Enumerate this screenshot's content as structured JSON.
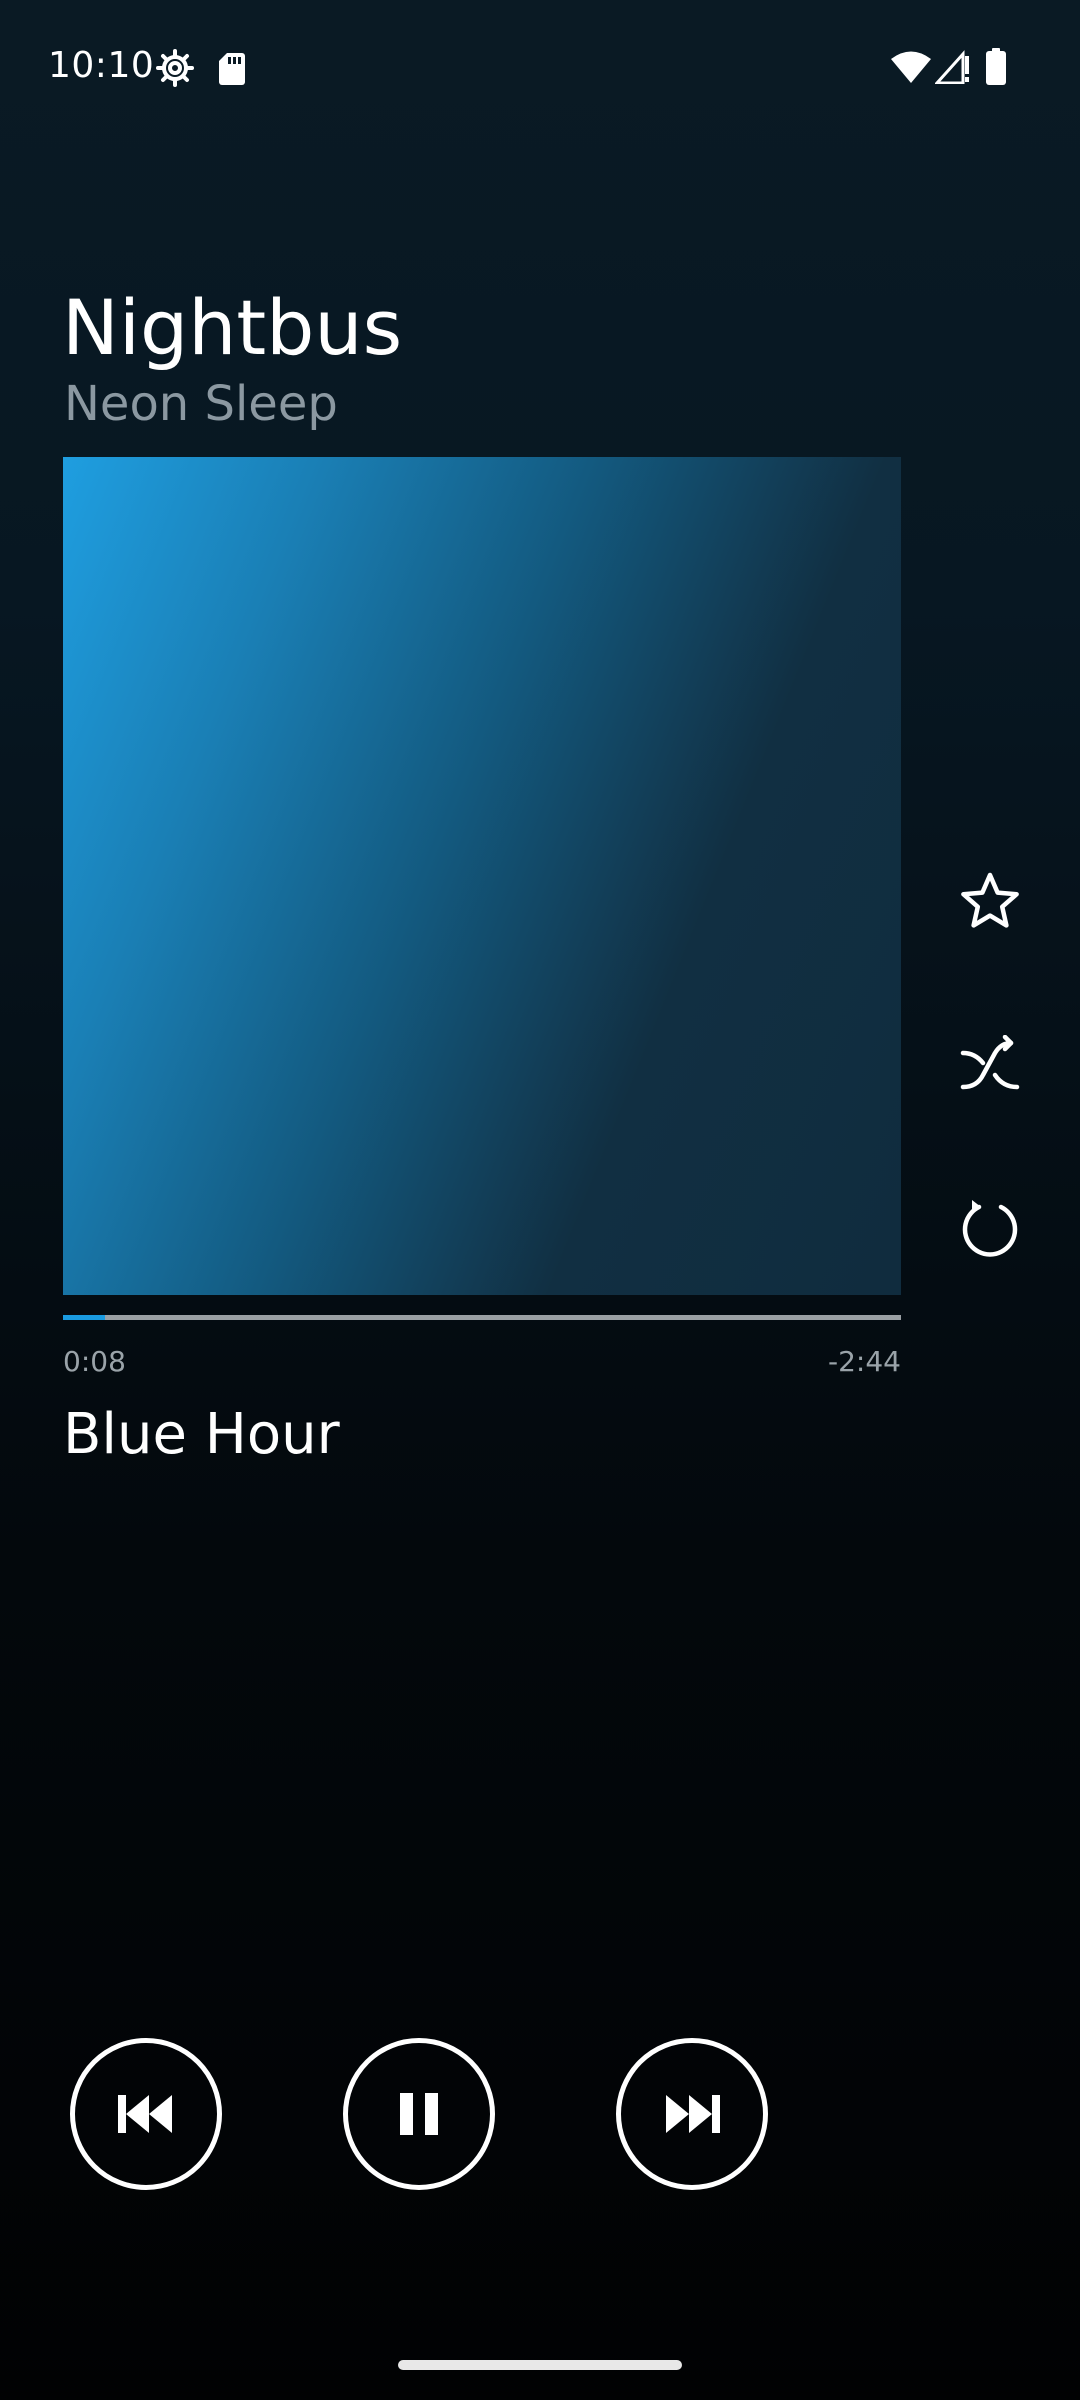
{
  "status_bar": {
    "time": "10:10",
    "icons": [
      "settings-gear-icon",
      "sd-card-icon",
      "wifi-icon",
      "cellular-signal-icon",
      "battery-icon"
    ]
  },
  "now_playing": {
    "album": "Nightbus",
    "artist": "Neon Sleep",
    "track": "Blue Hour",
    "elapsed": "0:08",
    "remaining": "-2:44",
    "progress_fraction": 0.05
  },
  "side_actions": [
    {
      "name": "favorite",
      "icon": "star-outline-icon"
    },
    {
      "name": "shuffle",
      "icon": "shuffle-icon"
    },
    {
      "name": "repeat",
      "icon": "repeat-icon"
    }
  ],
  "transport": [
    {
      "name": "previous",
      "icon": "skip-previous-icon"
    },
    {
      "name": "pause",
      "icon": "pause-icon"
    },
    {
      "name": "next",
      "icon": "skip-next-icon"
    }
  ],
  "colors": {
    "accent": "#1a9be0",
    "background_top": "#0a1a24",
    "background_bottom": "#010203",
    "muted_text": "#8b98a1"
  }
}
